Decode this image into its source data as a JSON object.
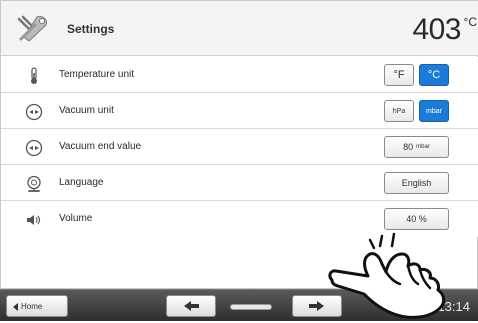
{
  "header": {
    "title": "Settings",
    "temperature": "403",
    "temperature_unit": "°C",
    "icon": "tools-icon"
  },
  "rows": [
    {
      "label": "Temperature unit",
      "icon": "thermometer-icon",
      "options": [
        "°F",
        "°C"
      ],
      "selected": "°C"
    },
    {
      "label": "Vacuum unit",
      "icon": "vacuum-icon",
      "options": [
        "hPa",
        "mbar"
      ],
      "selected": "mbar"
    },
    {
      "label": "Vacuum end value",
      "icon": "vacuum-icon",
      "value": "80",
      "unit": "mbar"
    },
    {
      "label": "Language",
      "icon": "language-icon",
      "value": "English"
    },
    {
      "label": "Volume",
      "icon": "speaker-icon",
      "value": "40 %"
    }
  ],
  "footer": {
    "home_label": "Home",
    "back_icon": "arrow-left-icon",
    "forward_icon": "arrow-right-icon",
    "time": "13:14"
  },
  "overlay": {
    "icon": "pointing-hand-icon"
  },
  "colors": {
    "accent": "#1b7bd6",
    "header_bg": "#f4f4f4",
    "footer_bar": "#3a3a3a"
  }
}
